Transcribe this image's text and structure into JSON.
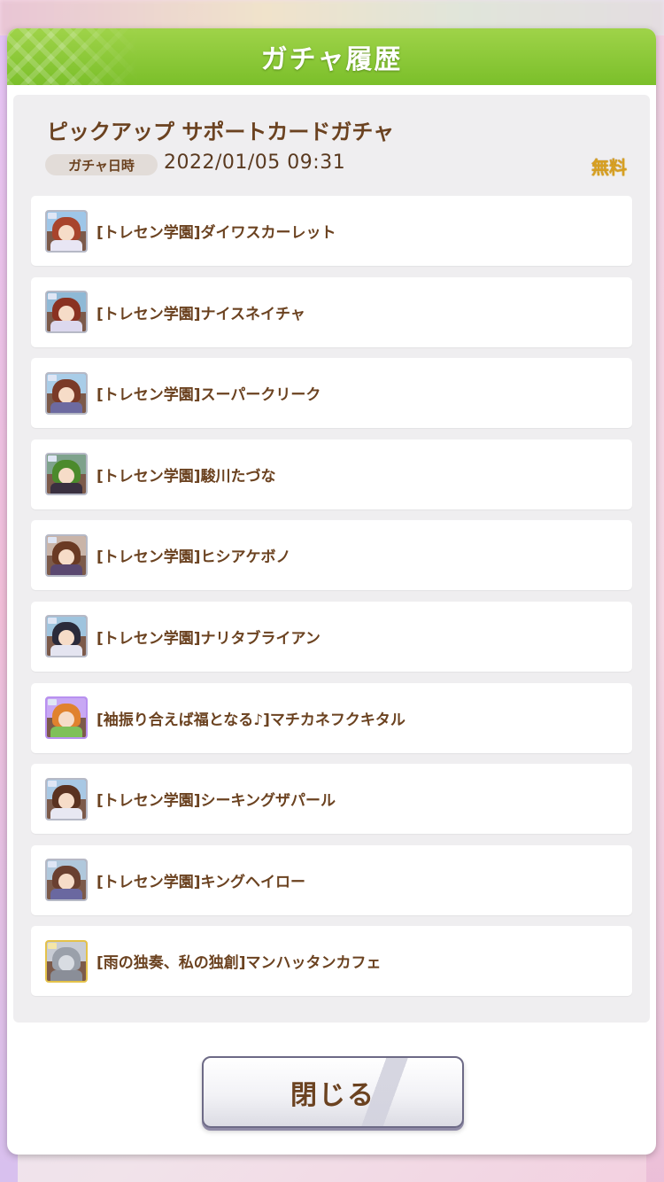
{
  "dialog": {
    "title": "ガチャ履歴",
    "gacha_name": "ピックアップ サポートカードガチャ",
    "date_label": "ガチャ日時",
    "date_value": "2022/01/05 09:31",
    "price": "無料",
    "close_label": "閉じる"
  },
  "results": [
    {
      "label": "[トレセン学園]ダイワスカーレット",
      "icon": "support-card-thumbnail"
    },
    {
      "label": "[トレセン学園]ナイスネイチャ",
      "icon": "support-card-thumbnail"
    },
    {
      "label": "[トレセン学園]スーパークリーク",
      "icon": "support-card-thumbnail"
    },
    {
      "label": "[トレセン学園]駿川たづな",
      "icon": "support-card-thumbnail"
    },
    {
      "label": "[トレセン学園]ヒシアケボノ",
      "icon": "support-card-thumbnail"
    },
    {
      "label": "[トレセン学園]ナリタブライアン",
      "icon": "support-card-thumbnail"
    },
    {
      "label": "[袖振り合えば福となる♪]マチカネフクキタル",
      "icon": "support-card-thumbnail"
    },
    {
      "label": "[トレセン学園]シーキングザパール",
      "icon": "support-card-thumbnail"
    },
    {
      "label": "[トレセン学園]キングヘイロー",
      "icon": "support-card-thumbnail"
    },
    {
      "label": "[雨の独奏、私の独創]マンハッタンカフェ",
      "icon": "support-card-thumbnail"
    }
  ],
  "colors": {
    "header_green": "#8cc63f",
    "text_brown": "#6b4220",
    "price_gold": "#d8a020"
  }
}
